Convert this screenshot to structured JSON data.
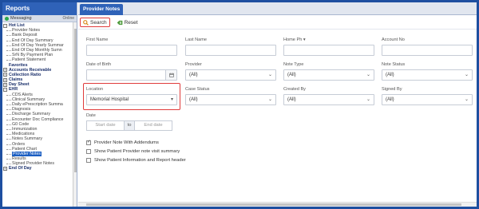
{
  "left": {
    "title": "Reports",
    "messaging": {
      "label": "Messaging",
      "status": "Online"
    },
    "tree": [
      {
        "type": "group",
        "label": "Hot List",
        "exp": "-"
      },
      {
        "type": "child",
        "label": "Provider Notes"
      },
      {
        "type": "child",
        "label": "Bank Deposit"
      },
      {
        "type": "child",
        "label": "End Of Day Summary"
      },
      {
        "type": "child",
        "label": "End Of Day Yearly Summar"
      },
      {
        "type": "child",
        "label": "End Of Day Monthly Sumn"
      },
      {
        "type": "child",
        "label": "SrN By Payment Plan"
      },
      {
        "type": "child",
        "label": "Patient Statement"
      },
      {
        "type": "group",
        "label": "Favorites",
        "exp": ""
      },
      {
        "type": "group",
        "label": "Accounts Receivable",
        "exp": "+"
      },
      {
        "type": "group",
        "label": "Collection Ratio",
        "exp": "+"
      },
      {
        "type": "group",
        "label": "Claims",
        "exp": "+"
      },
      {
        "type": "group",
        "label": "Day Sheet",
        "exp": "+"
      },
      {
        "type": "group",
        "label": "EHR",
        "exp": "-"
      },
      {
        "type": "child",
        "label": "CDS Alerts"
      },
      {
        "type": "child",
        "label": "Clinical Summary"
      },
      {
        "type": "child",
        "label": "Daily ePrescription Summa"
      },
      {
        "type": "child",
        "label": "Diagnosis"
      },
      {
        "type": "child",
        "label": "Discharge Summary"
      },
      {
        "type": "child",
        "label": "Encounter Doc Compliance"
      },
      {
        "type": "child",
        "label": "G0 Code"
      },
      {
        "type": "child",
        "label": "Immunization"
      },
      {
        "type": "child",
        "label": "Medications"
      },
      {
        "type": "child",
        "label": "Notes Summary"
      },
      {
        "type": "child",
        "label": "Orders"
      },
      {
        "type": "child",
        "label": "Patient Chart"
      },
      {
        "type": "child",
        "label": "Provider Notes",
        "active": true
      },
      {
        "type": "child",
        "label": "Results"
      },
      {
        "type": "child",
        "label": "Signed Provider Notes"
      },
      {
        "type": "group",
        "label": "End Of Day",
        "exp": "+"
      }
    ]
  },
  "tab": {
    "label": "Provider Notes"
  },
  "toolbar": {
    "search": "Search",
    "reset": "Reset"
  },
  "form": {
    "first_name": "First Name",
    "last_name": "Last Name",
    "home_ph": "Home Ph",
    "account_no": "Account No",
    "dob": "Date of Birth",
    "provider": {
      "label": "Provider",
      "value": "(All)"
    },
    "note_type": {
      "label": "Note Type",
      "value": "(All)"
    },
    "note_status": {
      "label": "Note Status",
      "value": "(All)"
    },
    "location": {
      "label": "Location",
      "value": "Memorial Hospital"
    },
    "case_status": {
      "label": "Case Status",
      "value": "(All)"
    },
    "created_by": {
      "label": "Created By",
      "value": "(All)"
    },
    "signed_by": {
      "label": "Signed By",
      "value": "(All)"
    },
    "date": {
      "label": "Date",
      "start": "Start date",
      "to": "to",
      "end": "End date"
    },
    "checks": [
      {
        "label": "Provider Note With Addendums",
        "checked": true
      },
      {
        "label": "Show Patient Provider note visit summary",
        "checked": false
      },
      {
        "label": "Show Patient Information and Report header",
        "checked": false
      }
    ]
  },
  "colors": {
    "header_blue": "#2f62b8",
    "highlight_red": "#e03b3b",
    "outer_blue": "#1e4fa0"
  }
}
